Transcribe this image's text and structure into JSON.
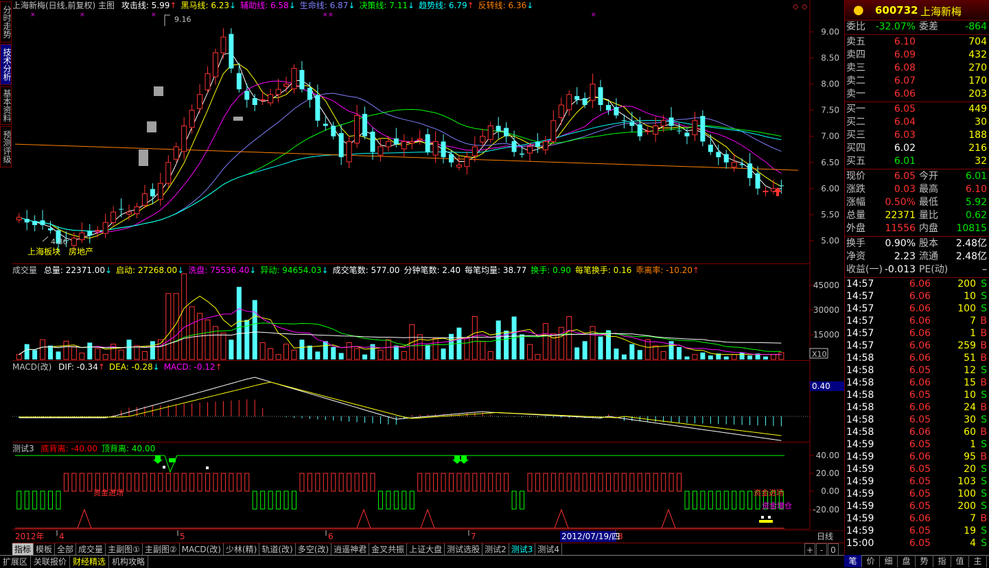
{
  "side_tabs": [
    {
      "label": "分时走势",
      "active": false
    },
    {
      "label": "技术分析",
      "active": true
    },
    {
      "label": "基本资料",
      "active": false
    },
    {
      "label": "预测评级",
      "active": false
    }
  ],
  "main": {
    "title": "上海新梅(日线,前复权) 主图",
    "indicators": [
      {
        "label": "攻击线: 5.99",
        "arrow": "↑",
        "color": "#ffffff"
      },
      {
        "label": "黑马线: 6.23",
        "arrow": "↓",
        "color": "#ffff00"
      },
      {
        "label": "辅助线: 6.58",
        "arrow": "↓",
        "color": "#ff00ff"
      },
      {
        "label": "生命线: 6.87",
        "arrow": "↓",
        "color": "#8080ff"
      },
      {
        "label": "决策线: 7.11",
        "arrow": "↓",
        "color": "#00ff00"
      },
      {
        "label": "趋势线: 6.79",
        "arrow": "↑",
        "color": "#00ffff"
      },
      {
        "label": "反转线: 6.36",
        "arrow": "↓",
        "color": "#ff8000"
      }
    ],
    "y_ticks": [
      "9.00",
      "8.50",
      "8.00",
      "7.50",
      "7.00",
      "6.50",
      "6.00",
      "5.50",
      "5.00"
    ],
    "high_label": "9.16",
    "low_label": "4.86",
    "sector_label": "上海板块",
    "industry_label": "房地产"
  },
  "volume": {
    "title": "成交量",
    "items": [
      {
        "label": "总量: 22371.00",
        "arrow": "↓",
        "color": "#ffffff"
      },
      {
        "label": "启动: 27268.00",
        "arrow": "↓",
        "color": "#ffff00"
      },
      {
        "label": "洗盘: 75536.40",
        "arrow": "↓",
        "color": "#ff00ff"
      },
      {
        "label": "异动: 94654.03",
        "arrow": "↓",
        "color": "#00ff00"
      },
      {
        "label": "成交笔数: 577.00",
        "arrow": "",
        "color": "#ffffff"
      },
      {
        "label": "分钟笔数: 2.40",
        "arrow": "",
        "color": "#ffffff"
      },
      {
        "label": "每笔均量: 38.77",
        "arrow": "",
        "color": "#ffffff"
      },
      {
        "label": "换手: 0.90",
        "arrow": "",
        "color": "#00ff00"
      },
      {
        "label": "每笔换手: 0.16",
        "arrow": "",
        "color": "#ffff00"
      },
      {
        "label": "乖离率: -10.20",
        "arrow": "↑",
        "color": "#ff8000"
      }
    ],
    "y_ticks": [
      "45000",
      "30000",
      "15000"
    ],
    "unit": "X10"
  },
  "macd": {
    "title": "MACD(改)",
    "items": [
      {
        "label": "DIF: -0.34",
        "arrow": "↑",
        "color": "#ffffff"
      },
      {
        "label": "DEA: -0.28",
        "arrow": "↓",
        "color": "#ffff00"
      },
      {
        "label": "MACD: -0.12",
        "arrow": "↑",
        "color": "#ff00ff"
      }
    ],
    "tag": "0.40"
  },
  "test3": {
    "title": "测试3",
    "items": [
      {
        "label": "底背离: -40.00",
        "color": "#ff0000"
      },
      {
        "label": "顶背离: 40.00",
        "color": "#00ff00"
      }
    ],
    "y_ticks": [
      "40.00",
      "20.00",
      "0.00",
      "-20.00"
    ],
    "label_fund_in": "资金进场",
    "label_fund_out": "资金进场",
    "label_add": "资金增仓"
  },
  "date_axis": {
    "year": "2012年",
    "months": [
      "4",
      "5",
      "6",
      "7",
      "8"
    ],
    "cursor_date": "2012/07/19/四",
    "period": "日线"
  },
  "quote": {
    "code": "600732",
    "name": "上海新梅",
    "weibi_label": "委比",
    "weibi": "-32.07%",
    "weicha_label": "委差",
    "weicha": "-864",
    "asks": [
      {
        "label": "卖五",
        "price": "6.10",
        "vol": "704"
      },
      {
        "label": "卖四",
        "price": "6.09",
        "vol": "432"
      },
      {
        "label": "卖三",
        "price": "6.08",
        "vol": "270"
      },
      {
        "label": "卖二",
        "price": "6.07",
        "vol": "170"
      },
      {
        "label": "卖一",
        "price": "6.06",
        "vol": "203"
      }
    ],
    "bids": [
      {
        "label": "买一",
        "price": "6.05",
        "vol": "449",
        "pcolor": "#ff3232"
      },
      {
        "label": "买二",
        "price": "6.04",
        "vol": "30",
        "pcolor": "#ff3232"
      },
      {
        "label": "买三",
        "price": "6.03",
        "vol": "188",
        "pcolor": "#ff3232"
      },
      {
        "label": "买四",
        "price": "6.02",
        "vol": "216",
        "pcolor": "#ffffff"
      },
      {
        "label": "买五",
        "price": "6.01",
        "vol": "32",
        "pcolor": "#00e600"
      }
    ],
    "stats": [
      [
        {
          "l": "现价",
          "v": "6.05",
          "c": "#ff3232"
        },
        {
          "l": "今开",
          "v": "6.01",
          "c": "#00e600"
        }
      ],
      [
        {
          "l": "涨跌",
          "v": "0.03",
          "c": "#ff3232"
        },
        {
          "l": "最高",
          "v": "6.10",
          "c": "#ff3232"
        }
      ],
      [
        {
          "l": "涨幅",
          "v": "0.50%",
          "c": "#ff3232"
        },
        {
          "l": "最低",
          "v": "5.92",
          "c": "#00e600"
        }
      ],
      [
        {
          "l": "总量",
          "v": "22371",
          "c": "#ffff00"
        },
        {
          "l": "量比",
          "v": "0.62",
          "c": "#00e600"
        }
      ],
      [
        {
          "l": "外盘",
          "v": "11556",
          "c": "#ff3232"
        },
        {
          "l": "内盘",
          "v": "10815",
          "c": "#00e600"
        }
      ]
    ],
    "stats2": [
      [
        {
          "l": "换手",
          "v": "0.90%",
          "c": "#ffffff"
        },
        {
          "l": "股本",
          "v": "2.48亿",
          "c": "#ffffff"
        }
      ],
      [
        {
          "l": "净资",
          "v": "2.23",
          "c": "#ffffff"
        },
        {
          "l": "流通",
          "v": "2.48亿",
          "c": "#ffffff"
        }
      ],
      [
        {
          "l": "收益(一)",
          "v": "-0.013",
          "c": "#ffffff"
        },
        {
          "l": "PE(动)",
          "v": "–",
          "c": "#ffffff"
        }
      ]
    ],
    "ticks": [
      {
        "t": "14:57",
        "p": "6.06",
        "v": "200",
        "s": "S"
      },
      {
        "t": "14:57",
        "p": "6.06",
        "v": "10",
        "s": "S"
      },
      {
        "t": "14:57",
        "p": "6.06",
        "v": "100",
        "s": "S"
      },
      {
        "t": "14:57",
        "p": "6.06",
        "v": "7",
        "s": "B"
      },
      {
        "t": "14:57",
        "p": "6.06",
        "v": "1",
        "s": "B"
      },
      {
        "t": "14:57",
        "p": "6.06",
        "v": "259",
        "s": "B"
      },
      {
        "t": "14:58",
        "p": "6.06",
        "v": "51",
        "s": "B"
      },
      {
        "t": "14:58",
        "p": "6.05",
        "v": "12",
        "s": "S"
      },
      {
        "t": "14:58",
        "p": "6.06",
        "v": "15",
        "s": "B"
      },
      {
        "t": "14:58",
        "p": "6.05",
        "v": "10",
        "s": "S"
      },
      {
        "t": "14:58",
        "p": "6.06",
        "v": "24",
        "s": "B"
      },
      {
        "t": "14:58",
        "p": "6.05",
        "v": "30",
        "s": "S"
      },
      {
        "t": "14:58",
        "p": "6.06",
        "v": "60",
        "s": "B"
      },
      {
        "t": "14:59",
        "p": "6.05",
        "v": "1",
        "s": "S"
      },
      {
        "t": "14:59",
        "p": "6.06",
        "v": "95",
        "s": "B"
      },
      {
        "t": "14:59",
        "p": "6.05",
        "v": "20",
        "s": "S"
      },
      {
        "t": "14:59",
        "p": "6.05",
        "v": "103",
        "s": "S"
      },
      {
        "t": "14:59",
        "p": "6.05",
        "v": "100",
        "s": "S"
      },
      {
        "t": "14:59",
        "p": "6.05",
        "v": "200",
        "s": "S"
      },
      {
        "t": "14:59",
        "p": "6.06",
        "v": "7",
        "s": "B"
      },
      {
        "t": "14:59",
        "p": "6.05",
        "v": "19",
        "s": "S"
      },
      {
        "t": "15:00",
        "p": "6.05",
        "v": "4",
        "s": "S"
      }
    ]
  },
  "bottom_tabs": [
    {
      "label": "指标",
      "active": true,
      "cyan": false
    },
    {
      "label": "模板",
      "active": false,
      "cyan": false
    },
    {
      "label": "全部",
      "active": false,
      "cyan": false
    },
    {
      "label": "成交量",
      "active": false,
      "cyan": false
    },
    {
      "label": "主副图①",
      "active": false,
      "cyan": false
    },
    {
      "label": "主副图②",
      "active": false,
      "cyan": false
    },
    {
      "label": "MACD(改)",
      "active": false,
      "cyan": false
    },
    {
      "label": "少林(精)",
      "active": false,
      "cyan": false
    },
    {
      "label": "轨道(改)",
      "active": false,
      "cyan": false
    },
    {
      "label": "多空(改)",
      "active": false,
      "cyan": false
    },
    {
      "label": "逍遥神君",
      "active": false,
      "cyan": false
    },
    {
      "label": "金叉共振",
      "active": false,
      "cyan": false
    },
    {
      "label": "上证大盘",
      "active": false,
      "cyan": false
    },
    {
      "label": "测试选股",
      "active": false,
      "cyan": false
    },
    {
      "label": "测试2",
      "active": false,
      "cyan": false
    },
    {
      "label": "测试3",
      "active": false,
      "cyan": true
    },
    {
      "label": "测试4",
      "active": false,
      "cyan": false
    }
  ],
  "status_tabs": [
    {
      "label": "扩展区",
      "yellow": false
    },
    {
      "label": "关联报价",
      "yellow": false
    },
    {
      "label": "财经精选",
      "yellow": true
    },
    {
      "label": "机构攻略",
      "yellow": false
    }
  ],
  "right_tabs": [
    {
      "label": "笔",
      "active": true
    },
    {
      "label": "价",
      "active": false
    },
    {
      "label": "细",
      "active": false
    },
    {
      "label": "盘",
      "active": false
    },
    {
      "label": "势",
      "active": false
    },
    {
      "label": "指",
      "active": false
    },
    {
      "label": "值",
      "active": false
    },
    {
      "label": "主",
      "active": false
    }
  ],
  "zoom_controls": {
    "plus": "+",
    "minus": "-",
    "zero": "0"
  }
}
